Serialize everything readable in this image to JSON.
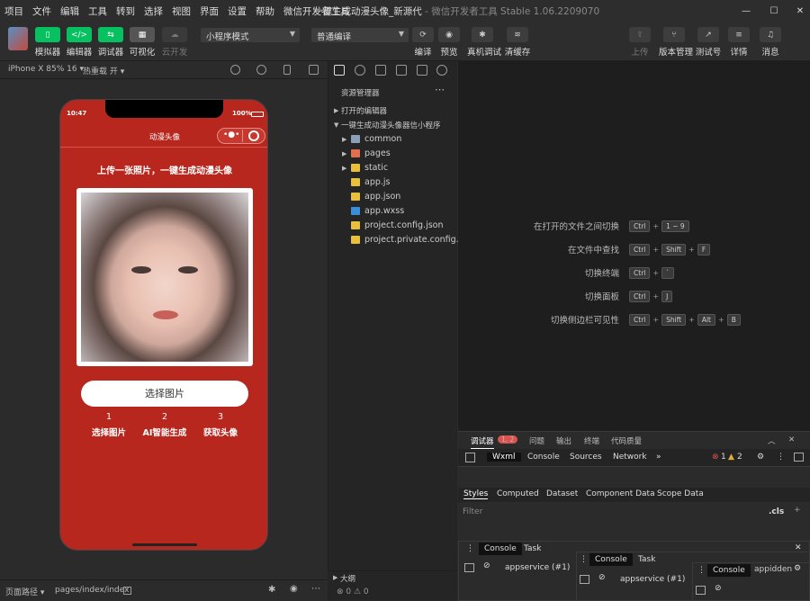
{
  "menu": [
    "项目",
    "文件",
    "编辑",
    "工具",
    "转到",
    "选择",
    "视图",
    "界面",
    "设置",
    "帮助",
    "微信开发者工具"
  ],
  "window": {
    "project": "一键生成动漫头像_新源代",
    "app": " - 微信开发者工具 Stable 1.06.2209070",
    "min": "—",
    "max": "☐",
    "close": "✕"
  },
  "toolbar": {
    "left": [
      {
        "label": "模拟器",
        "icon": "▯"
      },
      {
        "label": "编辑器",
        "icon": "</>"
      },
      {
        "label": "调试器",
        "icon": "⇆"
      },
      {
        "label": "可视化",
        "icon": "▦"
      },
      {
        "label": "云开发",
        "icon": "☁"
      }
    ],
    "mode_select": "小程序模式",
    "compile_select": "普通编译",
    "mid": [
      "编译",
      "预览",
      "真机调试",
      "清缓存"
    ],
    "right": [
      "上传",
      "版本管理",
      "测试号",
      "详情",
      "消息"
    ]
  },
  "simbar": {
    "device": "iPhone X 85% 16 ▾",
    "hotreload": "热重载 开 ▾"
  },
  "phone": {
    "time": "10:47",
    "battery": "100%",
    "title": "动漫头像",
    "heading": "上传一张照片，一键生成动漫头像",
    "button": "选择图片",
    "steps": [
      {
        "num": "1",
        "label": "选择图片"
      },
      {
        "num": "2",
        "label": "AI智能生成"
      },
      {
        "num": "3",
        "label": "获取头像"
      }
    ]
  },
  "statusbar": {
    "path_label": "页面路径 ▾",
    "path": "pages/index/index"
  },
  "explorer": {
    "title": "资源管理器",
    "open_editors": "打开的编辑器",
    "project": "一键生成动漫头像器信小程序",
    "items": [
      {
        "name": "common",
        "type": "folder"
      },
      {
        "name": "pages",
        "type": "folder"
      },
      {
        "name": "static",
        "type": "folder"
      },
      {
        "name": "app.js",
        "type": "js"
      },
      {
        "name": "app.json",
        "type": "json"
      },
      {
        "name": "app.wxss",
        "type": "wxss"
      },
      {
        "name": "project.config.json",
        "type": "json"
      },
      {
        "name": "project.private.config.js...",
        "type": "json"
      }
    ],
    "outline": "大纲",
    "problems": "⊗ 0 ⚠ 0"
  },
  "shortcuts": [
    {
      "label": "在打开的文件之间切换",
      "keys": [
        "Ctrl",
        "1 ~ 9"
      ]
    },
    {
      "label": "在文件中查找",
      "keys": [
        "Ctrl",
        "Shift",
        "F"
      ]
    },
    {
      "label": "切换终端",
      "keys": [
        "Ctrl",
        "`"
      ]
    },
    {
      "label": "切换面板",
      "keys": [
        "Ctrl",
        "J"
      ]
    },
    {
      "label": "切换侧边栏可见性",
      "keys": [
        "Ctrl",
        "Shift",
        "Alt",
        "B"
      ]
    }
  ],
  "debug": {
    "tabs": [
      "调试器",
      "问题",
      "输出",
      "终端",
      "代码质量"
    ],
    "badge": "1, 2",
    "devtabs": [
      "Wxml",
      "Console",
      "Sources",
      "Network",
      "»"
    ],
    "errors": "1",
    "warnings": "2",
    "subtabs": [
      "Styles",
      "Computed",
      "Dataset",
      "Component Data",
      "Scope Data"
    ],
    "filter": "Filter",
    "cls": ".cls",
    "drawer_tabs": [
      "Console",
      "Task"
    ],
    "context": "appservice (#1)",
    "hidden": "appidden"
  }
}
